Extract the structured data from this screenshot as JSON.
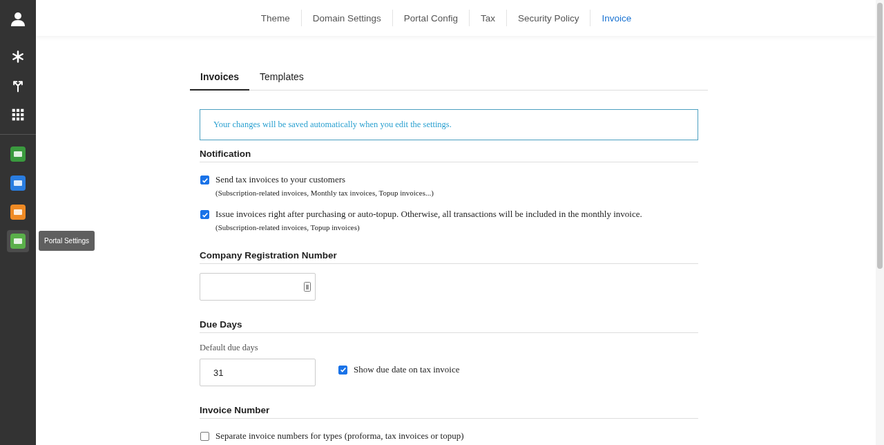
{
  "sidebar": {
    "items": [
      {
        "kind": "user",
        "selected": false
      },
      {
        "kind": "asterisk",
        "selected": false
      },
      {
        "kind": "fork",
        "selected": false
      },
      {
        "kind": "grid",
        "selected": false
      },
      {
        "kind": "app",
        "color": "#3a9a3e",
        "selected": false
      },
      {
        "kind": "app",
        "color": "#2a7de0",
        "selected": false
      },
      {
        "kind": "app",
        "color": "#ef8a24",
        "selected": false
      },
      {
        "kind": "app",
        "color": "#5aaf4a",
        "selected": true
      }
    ],
    "tooltip": "Portal Settings"
  },
  "top_tabs": [
    {
      "label": "Theme",
      "selected": false
    },
    {
      "label": "Domain Settings",
      "selected": false
    },
    {
      "label": "Portal Config",
      "selected": false
    },
    {
      "label": "Tax",
      "selected": false
    },
    {
      "label": "Security Policy",
      "selected": false
    },
    {
      "label": "Invoice",
      "selected": true
    }
  ],
  "sub_tabs": [
    {
      "label": "Invoices",
      "selected": true
    },
    {
      "label": "Templates",
      "selected": false
    }
  ],
  "notice": "Your changes will be saved automatically when you edit the settings.",
  "sections": [
    {
      "title": "Notification",
      "items": [
        {
          "kind": "checkbox",
          "label": "Send tax invoices to your customers",
          "hint": "(Subscription-related invoices, Monthly tax invoices, Topup invoices...)",
          "checked": true
        },
        {
          "kind": "checkbox",
          "label": "Issue invoices right after purchasing or auto-topup. Otherwise, all transactions will be included in the monthly invoice.",
          "hint": "(Subscription-related invoices, Topup invoices)",
          "checked": true
        }
      ]
    },
    {
      "title": "Company Registration Number",
      "items": [
        {
          "kind": "input",
          "value": ""
        }
      ]
    },
    {
      "title": "Due Days",
      "items": [
        {
          "kind": "input_check",
          "caption": "Default due days",
          "value": "31",
          "label": "Show due date on tax invoice",
          "checked": true
        }
      ]
    },
    {
      "title": "Invoice Number",
      "items": [
        {
          "kind": "checkbox",
          "label": "Separate invoice numbers for types (proforma, tax invoices or topup)",
          "checked": false
        }
      ]
    }
  ]
}
